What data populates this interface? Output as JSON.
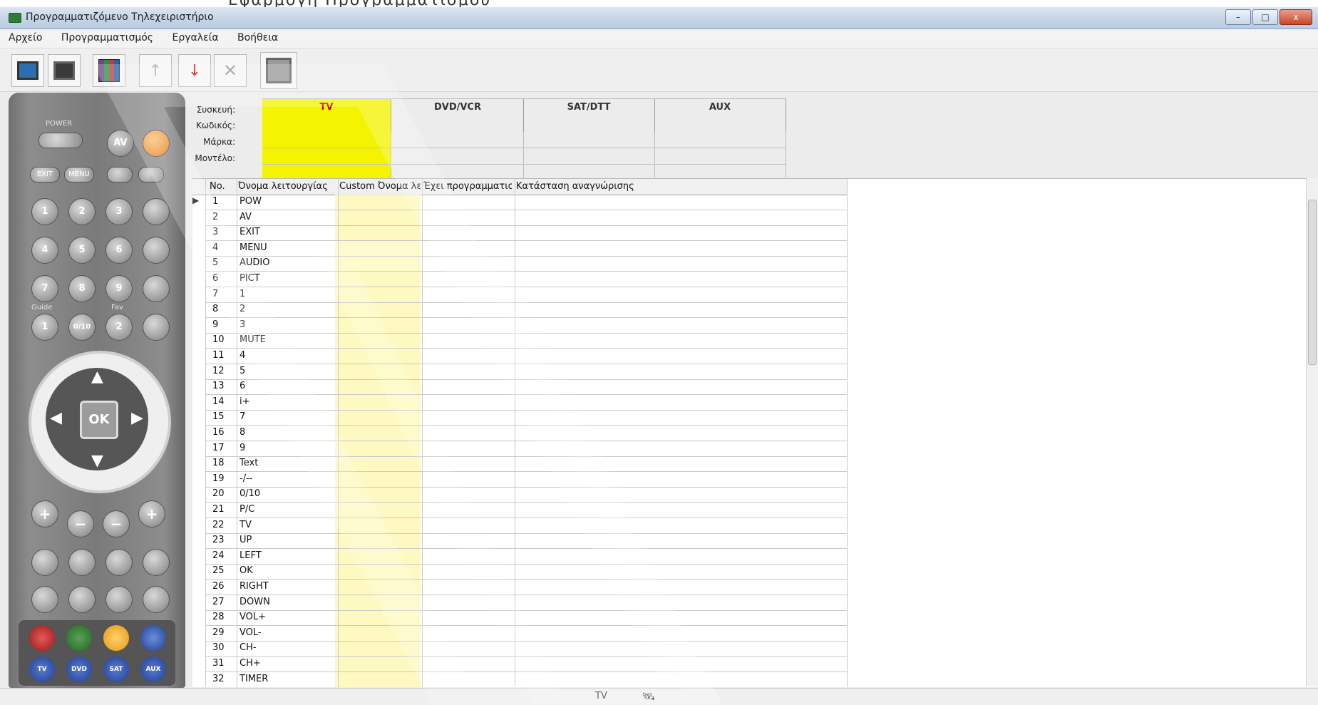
{
  "window": {
    "title": "Προγραμματιζόμενο Τηλεχειριστήριο",
    "controls": {
      "minimize": "–",
      "maximize": "□",
      "close": "x"
    }
  },
  "top_caption": "Εφαρμογή Προγραμματισμού",
  "menu": [
    "Αρχείο",
    "Προγραμματισμός",
    "Εργαλεία",
    "Βοήθεια"
  ],
  "toolbar": {
    "icons": [
      "remote-icon",
      "chip-icon",
      "library-icon",
      "arrow-up-icon",
      "arrow-down-icon",
      "delete-icon",
      "stop-icon"
    ]
  },
  "remote": {
    "power_label": "POWER",
    "guide_label": "Guide",
    "fav_label": "Fav",
    "ok_label": "OK",
    "top_buttons": [
      "EXIT",
      "MENU"
    ],
    "numpad": [
      "1",
      "2",
      "3",
      "4",
      "5",
      "6",
      "7",
      "8",
      "9",
      "1",
      "0/10",
      "2"
    ],
    "side_buttons": [
      "AV",
      "MENU"
    ],
    "media_buttons": [
      "TV",
      "DVD",
      "SAT",
      "AUX"
    ]
  },
  "device_header": {
    "labels": {
      "device": "Συσκευή:",
      "code": "Κωδικός:",
      "brand": "Μάρκα:",
      "model": "Μοντέλο:"
    },
    "tabs": [
      "TV",
      "DVD/VCR",
      "SAT/DTT",
      "AUX"
    ],
    "selected_tab": "TV"
  },
  "grid": {
    "columns": [
      "No.",
      "Όνομα λειτουργίας",
      "Custom Όνομα λειτουργίας",
      "Έχει προγραμματιστεί",
      "Κατάσταση αναγνώρισης"
    ],
    "rows": [
      {
        "no": "1",
        "name": "POW"
      },
      {
        "no": "2",
        "name": "AV"
      },
      {
        "no": "3",
        "name": "EXIT"
      },
      {
        "no": "4",
        "name": "MENU"
      },
      {
        "no": "5",
        "name": "AUDIO"
      },
      {
        "no": "6",
        "name": "PICT"
      },
      {
        "no": "7",
        "name": "1"
      },
      {
        "no": "8",
        "name": "2"
      },
      {
        "no": "9",
        "name": "3"
      },
      {
        "no": "10",
        "name": "MUTE"
      },
      {
        "no": "11",
        "name": "4"
      },
      {
        "no": "12",
        "name": "5"
      },
      {
        "no": "13",
        "name": "6"
      },
      {
        "no": "14",
        "name": "i+"
      },
      {
        "no": "15",
        "name": "7"
      },
      {
        "no": "16",
        "name": "8"
      },
      {
        "no": "17",
        "name": "9"
      },
      {
        "no": "18",
        "name": "Text"
      },
      {
        "no": "19",
        "name": "-/--"
      },
      {
        "no": "20",
        "name": "0/10"
      },
      {
        "no": "21",
        "name": "P/C"
      },
      {
        "no": "22",
        "name": "TV"
      },
      {
        "no": "23",
        "name": "UP"
      },
      {
        "no": "24",
        "name": "LEFT"
      },
      {
        "no": "25",
        "name": "OK"
      },
      {
        "no": "26",
        "name": "RIGHT"
      },
      {
        "no": "27",
        "name": "DOWN"
      },
      {
        "no": "28",
        "name": "VOL+"
      },
      {
        "no": "29",
        "name": "VOL-"
      },
      {
        "no": "30",
        "name": "CH-"
      },
      {
        "no": "31",
        "name": "CH+"
      },
      {
        "no": "32",
        "name": "TIMER"
      }
    ]
  },
  "statusbar": {
    "device": "TV"
  },
  "colors": {
    "accent_yellow": "#f4f400",
    "selected_tab_text": "#cc0000"
  }
}
